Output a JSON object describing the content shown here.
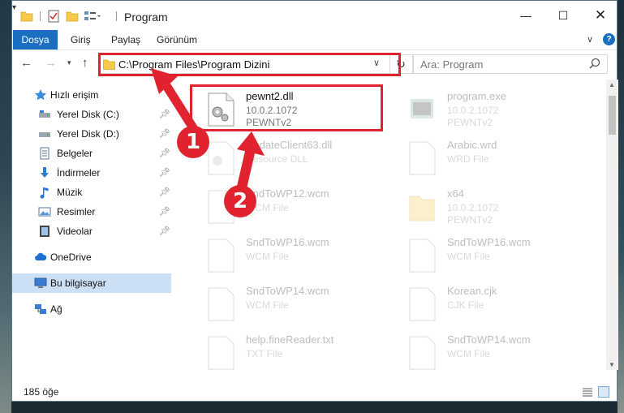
{
  "window": {
    "title": "Program",
    "controls": {
      "minimize": "—",
      "maximize": "☐",
      "close": "✕"
    }
  },
  "ribbon": {
    "tabs": [
      "Dosya",
      "Giriş",
      "Paylaş",
      "Görünüm"
    ],
    "active_tab": "Dosya",
    "help": "?"
  },
  "nav": {
    "back": "←",
    "forward": "→",
    "up": "↑",
    "address": "C:\\Program Files\\Program Dizini",
    "search_placeholder": "Ara: Program"
  },
  "sidebar": {
    "items": [
      {
        "label": "Hızlı erişim",
        "icon": "star-icon",
        "pinned": false
      },
      {
        "label": "Yerel Disk (C:)",
        "icon": "drive-icon",
        "pinned": true
      },
      {
        "label": "Yerel Disk (D:)",
        "icon": "drive-icon",
        "pinned": true
      },
      {
        "label": "Belgeler",
        "icon": "documents-icon",
        "pinned": true
      },
      {
        "label": "İndirmeler",
        "icon": "download-icon",
        "pinned": true
      },
      {
        "label": "Müzik",
        "icon": "music-icon",
        "pinned": true
      },
      {
        "label": "Resimler",
        "icon": "pictures-icon",
        "pinned": true
      },
      {
        "label": "Videolar",
        "icon": "videos-icon",
        "pinned": true
      },
      {
        "label": "OneDrive",
        "icon": "cloud-icon",
        "pinned": false
      },
      {
        "label": "Bu bilgisayar",
        "icon": "computer-icon",
        "pinned": false,
        "selected": true
      },
      {
        "label": "Ağ",
        "icon": "network-icon",
        "pinned": false
      }
    ]
  },
  "files": [
    {
      "name": "pewnt2.dll",
      "line1": "10.0.2.1072",
      "line2": "PEWNTv2",
      "icon": "dll-file-icon",
      "highlighted": true
    },
    {
      "name": "program.exe",
      "line1": "10.0.2.1072",
      "line2": "PEWNTv2",
      "icon": "exe-file-icon"
    },
    {
      "name": "UpdateClient63.dll",
      "line1": "Resource DLL",
      "line2": "",
      "icon": "dll-file-icon"
    },
    {
      "name": "Arabic.wrd",
      "line1": "WRD File",
      "line2": "",
      "icon": "blank-file-icon"
    },
    {
      "name": "SndToWP12.wcm",
      "line1": "WCM File",
      "line2": "",
      "icon": "blank-file-icon"
    },
    {
      "name": "x64",
      "line1": "10.0.2.1072",
      "line2": "PEWNTv2",
      "icon": "folder-icon"
    },
    {
      "name": "SndToWP16.wcm",
      "line1": "WCM File",
      "line2": "",
      "icon": "blank-file-icon"
    },
    {
      "name": "SndToWP16.wcm",
      "line1": "WCM File",
      "line2": "",
      "icon": "blank-file-icon"
    },
    {
      "name": "SndToWP14.wcm",
      "line1": "WCM File",
      "line2": "",
      "icon": "blank-file-icon"
    },
    {
      "name": "Korean.cjk",
      "line1": "CJK File",
      "line2": "",
      "icon": "blank-file-icon"
    },
    {
      "name": "help.fineReader.txt",
      "line1": "TXT File",
      "line2": "",
      "icon": "blank-file-icon"
    },
    {
      "name": "SndToWP14.wcm",
      "line1": "WCM File",
      "line2": "",
      "icon": "blank-file-icon"
    }
  ],
  "status": {
    "count": "185 öğe"
  },
  "callouts": [
    "1",
    "2"
  ],
  "colors": {
    "accent": "#1a6fc2",
    "highlight": "#e0232f",
    "selected": "#cce0f5"
  }
}
